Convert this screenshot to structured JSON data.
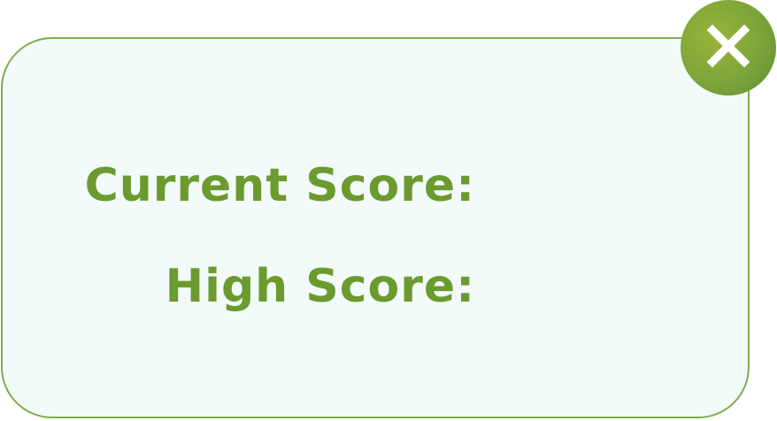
{
  "panel": {
    "current_score_label": "Current Score:",
    "high_score_label": "High Score:",
    "current_score_value": "",
    "high_score_value": ""
  },
  "close_button": {
    "icon": "close-icon"
  },
  "colors": {
    "panel_background": "#f2fbfa",
    "panel_border": "#7fac4c",
    "label_text": "#6b9a2e",
    "close_button": "#7ba53a"
  }
}
